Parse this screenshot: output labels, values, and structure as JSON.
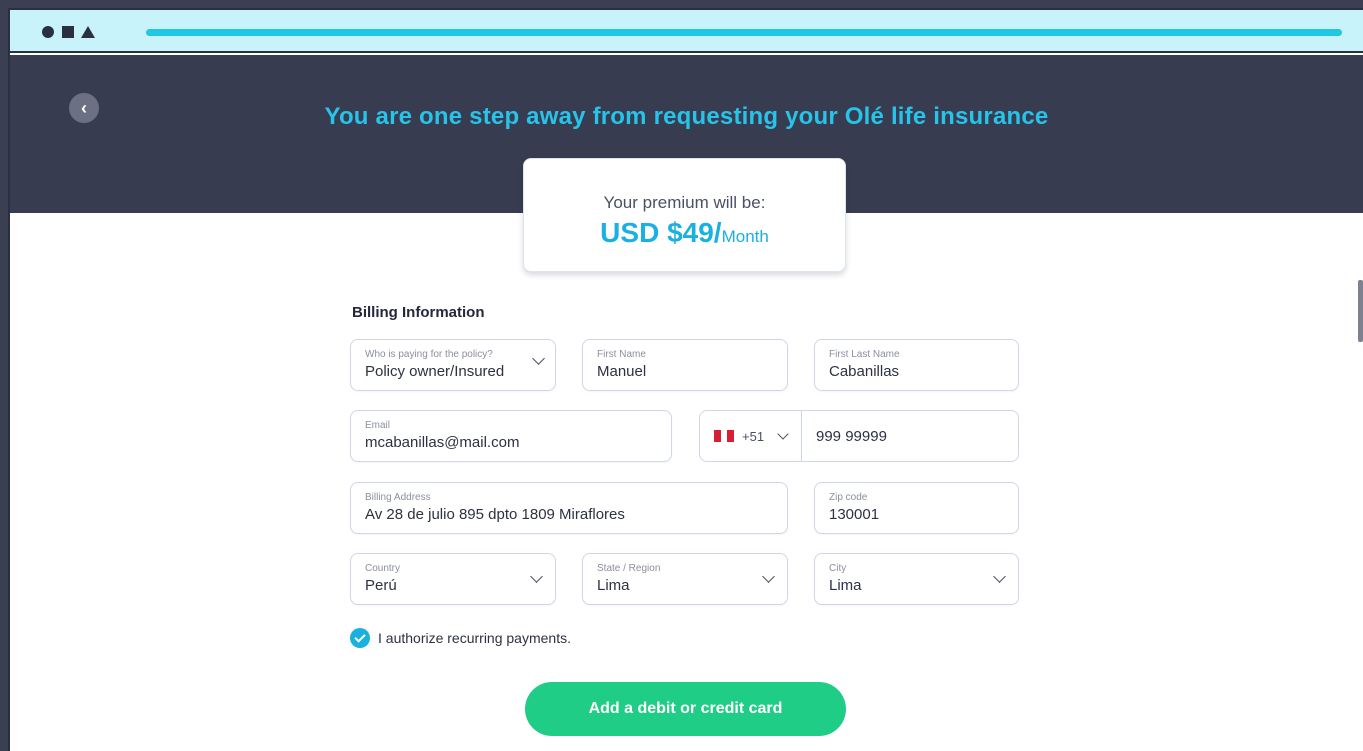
{
  "window": {
    "controls": [
      "circle-icon",
      "square-icon",
      "triangle-icon"
    ]
  },
  "header": {
    "back_icon": "chevron-left-icon",
    "back_glyph": "‹",
    "title": "You are one step away from requesting your Olé life insurance"
  },
  "premium": {
    "label": "Your premium will be:",
    "amount": "USD $49/",
    "period": "Month"
  },
  "billing": {
    "title": "Billing Information",
    "payer": {
      "label": "Who is paying for the policy?",
      "value": "Policy owner/Insured"
    },
    "first_name": {
      "label": "First Name",
      "value": "Manuel"
    },
    "last_name": {
      "label": "First Last Name",
      "value": "Cabanillas"
    },
    "email": {
      "label": "Email",
      "value": "mcabanillas@mail.com"
    },
    "phone": {
      "country_flag": "peru-flag-icon",
      "code": "+51",
      "number": "999 99999"
    },
    "address": {
      "label": "Billing Address",
      "value": "Av 28 de julio 895 dpto 1809 Miraflores"
    },
    "zip": {
      "label": "Zip code",
      "value": "130001"
    },
    "country": {
      "label": "Country",
      "value": "Perú"
    },
    "state": {
      "label": "State / Region",
      "value": "Lima"
    },
    "city": {
      "label": "City",
      "value": "Lima"
    },
    "recurring": {
      "checked": true,
      "label": "I authorize recurring payments."
    },
    "submit_label": "Add a debit or credit card"
  },
  "colors": {
    "accent": "#1ab0df",
    "header_bg": "#383c51",
    "cta": "#1fcd86",
    "chrome": "#c9f3fb"
  }
}
